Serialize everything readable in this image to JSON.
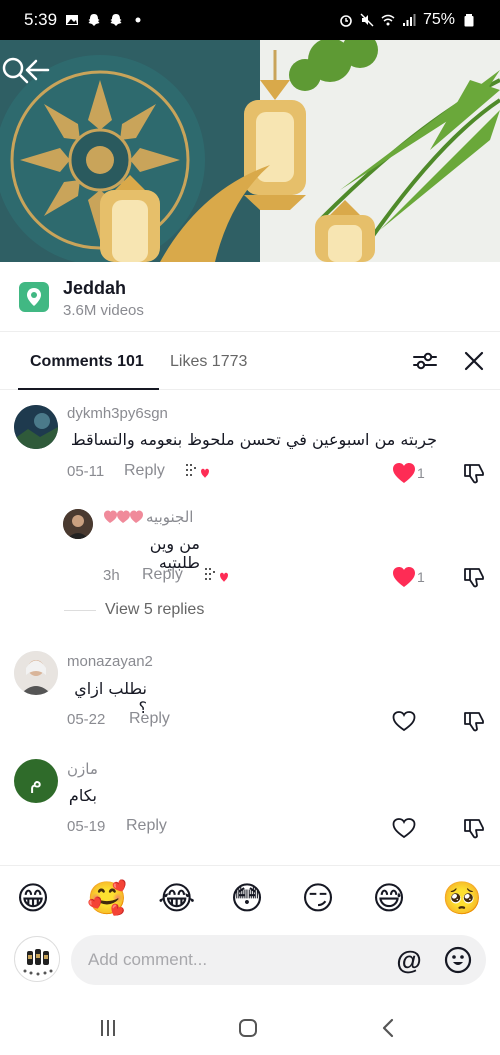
{
  "status_bar": {
    "time": "5:39",
    "battery": "75%"
  },
  "location": {
    "title": "Jeddah",
    "subtitle": "3.6M videos"
  },
  "tabs": {
    "comments": "Comments 101",
    "likes": "Likes 1773"
  },
  "comments": [
    {
      "username": "dykmh3py6sgn",
      "text": "جربته من اسبوعين في تحسن ملحوظ بنعومه والتساقط",
      "date": "05-11",
      "reply_label": "Reply",
      "likes": "1",
      "liked": true
    },
    {
      "username": "الجنوبيه",
      "text": "من وين طلبتيه",
      "date": "3h",
      "reply_label": "Reply",
      "likes": "1",
      "liked": true
    },
    {
      "username": "monazayan2",
      "text": "نطلب ازاي ؟",
      "date": "05-22",
      "reply_label": "Reply",
      "liked": false
    },
    {
      "username": "مازن",
      "text": "بكام",
      "date": "05-19",
      "reply_label": "Reply",
      "liked": false,
      "avatar_letter": "م"
    }
  ],
  "view_replies": "View 5 replies",
  "emoji_bar": [
    "😁",
    "🥰",
    "😂",
    "😳",
    "😏",
    "😅",
    "🥺"
  ],
  "input": {
    "placeholder": "Add comment...",
    "mention": "@"
  },
  "colors": {
    "heart": "#fe2c55",
    "location_icon": "#41b883",
    "avatar_green": "#2f6b2a"
  }
}
